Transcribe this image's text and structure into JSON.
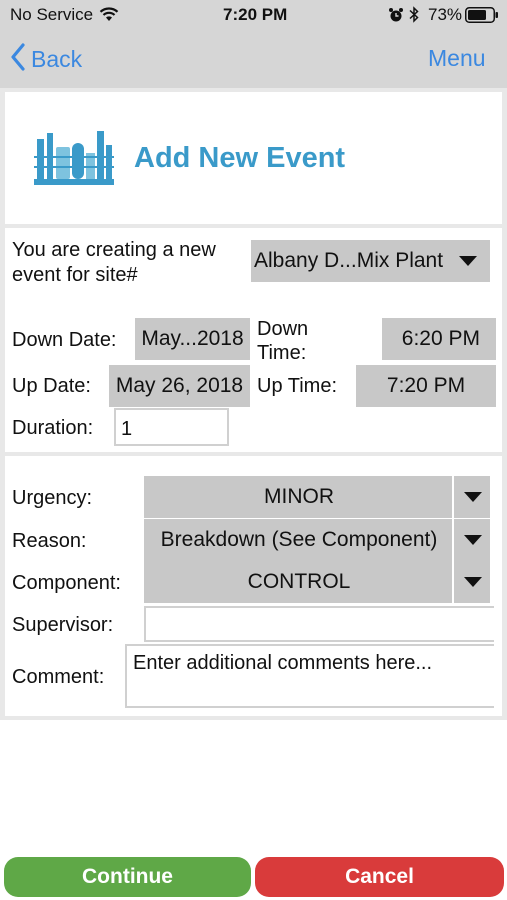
{
  "status_bar": {
    "carrier": "No Service",
    "time": "7:20 PM",
    "battery": "73%",
    "icons": [
      "wifi-icon",
      "alarm-icon",
      "bluetooth-icon",
      "battery-icon"
    ]
  },
  "nav": {
    "back_label": "Back",
    "menu_label": "Menu"
  },
  "header": {
    "title": "Add New Event",
    "logo_icon": "industrial-plant-icon"
  },
  "site": {
    "prompt": "You are creating a new event for site#",
    "selected": "Albany D...Mix Plant"
  },
  "dates": {
    "down_date_label": "Down Date:",
    "down_date_value": "May...2018",
    "down_time_label": "Down Time:",
    "down_time_value": "6:20 PM",
    "up_date_label": "Up Date:",
    "up_date_value": "May 26, 2018",
    "up_time_label": "Up Time:",
    "up_time_value": "7:20 PM",
    "duration_label": "Duration:",
    "duration_value": "1"
  },
  "details": {
    "urgency_label": "Urgency:",
    "urgency_value": "MINOR",
    "reason_label": "Reason:",
    "reason_value": "Breakdown (See Component)",
    "component_label": "Component:",
    "component_value": "CONTROL",
    "supervisor_label": "Supervisor:",
    "supervisor_value": "",
    "comment_label": "Comment:",
    "comment_placeholder": "Enter additional comments here..."
  },
  "actions": {
    "continue_label": "Continue",
    "cancel_label": "Cancel"
  },
  "colors": {
    "accent_blue": "#3b88e0",
    "title_blue": "#3a9ac9",
    "continue_green": "#5fa847",
    "cancel_red": "#d93b3b",
    "field_gray": "#c8c8c8"
  }
}
